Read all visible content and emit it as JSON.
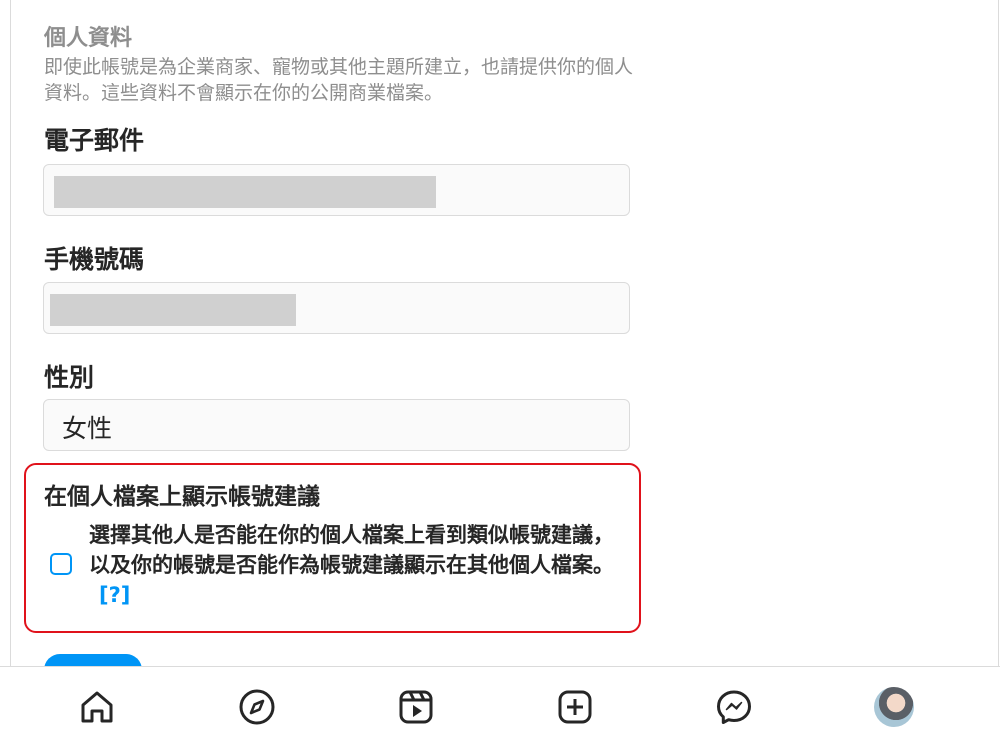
{
  "profile_info": {
    "title": "個人資料",
    "description": "即使此帳號是為企業商家、寵物或其他主題所建立，也請提供你的個人資料。這些資料不會顯示在你的公開商業檔案。"
  },
  "email": {
    "label": "電子郵件"
  },
  "phone": {
    "label": "手機號碼"
  },
  "gender": {
    "label": "性別",
    "value": "女性"
  },
  "account_suggestions": {
    "heading": "在個人檔案上顯示帳號建議",
    "description": "選擇其他人是否能在你的個人檔案上看到類似帳號建議，以及你的帳號是否能作為帳號建議顯示在其他個人檔案。",
    "help_link": "[?]",
    "checked": false
  },
  "bottom_nav": {
    "icons": [
      "home-icon",
      "explore-icon",
      "reels-icon",
      "new-post-icon",
      "messenger-icon",
      "profile-avatar"
    ]
  },
  "colors": {
    "accent": "#0095f6",
    "highlight": "#e0121b",
    "muted_text": "#8e8e8e"
  }
}
